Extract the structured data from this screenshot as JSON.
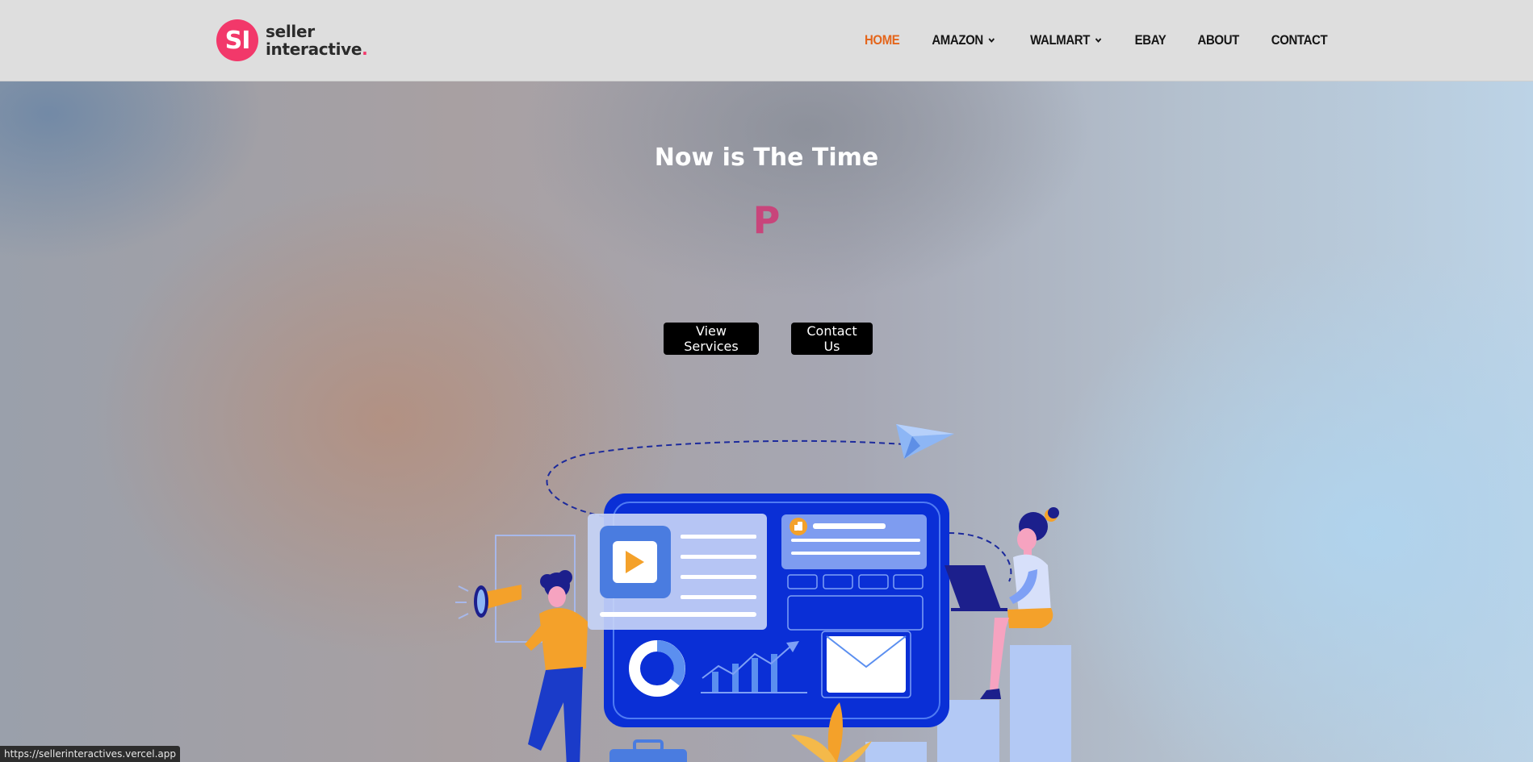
{
  "brand": {
    "badge": "SI",
    "line1": "seller",
    "line2": "interactive",
    "dot": "."
  },
  "nav": {
    "items": [
      {
        "label": "HOME",
        "active": true
      },
      {
        "label": "AMAZON",
        "dropdown": true
      },
      {
        "label": "WALMART",
        "dropdown": true
      },
      {
        "label": "EBAY"
      },
      {
        "label": "ABOUT"
      },
      {
        "label": "CONTACT"
      }
    ]
  },
  "hero": {
    "title": "Now is The Time",
    "typed_text": "P",
    "buttons": {
      "services": "View Services",
      "contact": "Contact Us"
    }
  },
  "status_bar": {
    "url": "https://sellerinteractives.vercel.app"
  },
  "colors": {
    "brand_pink": "#f2386a",
    "nav_active": "#e4661c",
    "typed_text": "#c8457b",
    "button_bg": "#000000",
    "illustration_blue": "#0a2fd6"
  },
  "icons": {
    "nav_dropdown": "chevron-down-icon",
    "illustration": "digital-marketing-illustration"
  }
}
